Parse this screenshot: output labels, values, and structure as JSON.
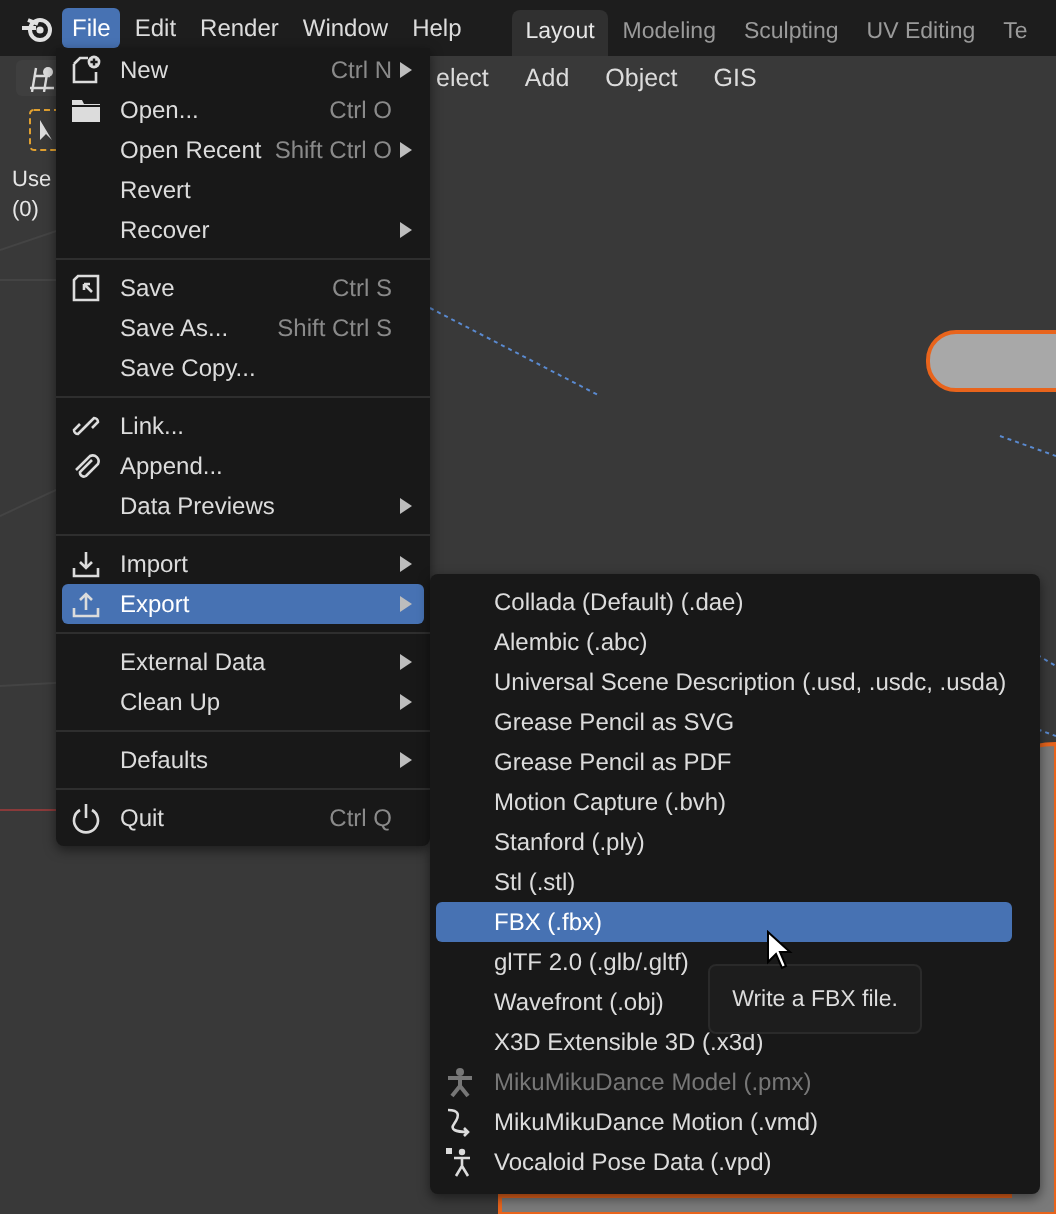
{
  "app_menu": [
    {
      "label": "File",
      "selected": true
    },
    {
      "label": "Edit",
      "selected": false
    },
    {
      "label": "Render",
      "selected": false
    },
    {
      "label": "Window",
      "selected": false
    },
    {
      "label": "Help",
      "selected": false
    }
  ],
  "workspace_tabs": [
    {
      "label": "Layout",
      "selected": true
    },
    {
      "label": "Modeling",
      "selected": false
    },
    {
      "label": "Sculpting",
      "selected": false
    },
    {
      "label": "UV Editing",
      "selected": false
    },
    {
      "label": "Te",
      "selected": false
    }
  ],
  "viewport_header": {
    "menus": [
      "elect",
      "Add",
      "Object",
      "GIS"
    ]
  },
  "viewport_overlay": [
    "Use",
    "(0)"
  ],
  "file_menu": {
    "items": [
      {
        "kind": "new",
        "label": "New",
        "shortcut": "Ctrl N",
        "submenu": true,
        "selected": false
      },
      {
        "kind": "open",
        "label": "Open...",
        "shortcut": "Ctrl O",
        "submenu": false,
        "selected": false
      },
      {
        "kind": "item",
        "label": "Open Recent",
        "shortcut": "Shift Ctrl O",
        "submenu": true,
        "selected": false
      },
      {
        "kind": "item",
        "label": "Revert",
        "submenu": false,
        "selected": false
      },
      {
        "kind": "item",
        "label": "Recover",
        "submenu": true,
        "selected": false
      },
      {
        "kind": "separator"
      },
      {
        "kind": "save",
        "label": "Save",
        "shortcut": "Ctrl S",
        "submenu": false,
        "selected": false
      },
      {
        "kind": "item",
        "label": "Save As...",
        "shortcut": "Shift Ctrl S",
        "submenu": false,
        "selected": false
      },
      {
        "kind": "item",
        "label": "Save Copy...",
        "submenu": false,
        "selected": false
      },
      {
        "kind": "separator"
      },
      {
        "kind": "link",
        "label": "Link...",
        "submenu": false,
        "selected": false
      },
      {
        "kind": "append",
        "label": "Append...",
        "submenu": false,
        "selected": false
      },
      {
        "kind": "item",
        "label": "Data Previews",
        "submenu": true,
        "selected": false
      },
      {
        "kind": "separator"
      },
      {
        "kind": "import",
        "label": "Import",
        "submenu": true,
        "selected": false
      },
      {
        "kind": "export",
        "label": "Export",
        "submenu": true,
        "selected": true
      },
      {
        "kind": "separator"
      },
      {
        "kind": "item",
        "label": "External Data",
        "submenu": true,
        "selected": false
      },
      {
        "kind": "item",
        "label": "Clean Up",
        "submenu": true,
        "selected": false
      },
      {
        "kind": "separator"
      },
      {
        "kind": "item",
        "label": "Defaults",
        "submenu": true,
        "selected": false
      },
      {
        "kind": "separator"
      },
      {
        "kind": "quit",
        "label": "Quit",
        "shortcut": "Ctrl Q",
        "submenu": false,
        "selected": false
      }
    ]
  },
  "export_menu": {
    "items": [
      {
        "label": "Collada (Default) (.dae)",
        "selected": false,
        "disabled": false
      },
      {
        "label": "Alembic (.abc)",
        "selected": false,
        "disabled": false
      },
      {
        "label": "Universal Scene Description (.usd, .usdc, .usda)",
        "selected": false,
        "disabled": false
      },
      {
        "label": "Grease Pencil as SVG",
        "selected": false,
        "disabled": false
      },
      {
        "label": "Grease Pencil as PDF",
        "selected": false,
        "disabled": false
      },
      {
        "label": "Motion Capture (.bvh)",
        "selected": false,
        "disabled": false
      },
      {
        "label": "Stanford (.ply)",
        "selected": false,
        "disabled": false
      },
      {
        "label": "Stl (.stl)",
        "selected": false,
        "disabled": false
      },
      {
        "label": "FBX (.fbx)",
        "selected": true,
        "disabled": false
      },
      {
        "label": "glTF 2.0 (.glb/.gltf)",
        "selected": false,
        "disabled": false
      },
      {
        "label": "Wavefront (.obj)",
        "selected": false,
        "disabled": false
      },
      {
        "label": "X3D Extensible 3D (.x3d)",
        "selected": false,
        "disabled": false
      },
      {
        "kind": "figure",
        "label": "MikuMikuDance Model (.pmx)",
        "selected": false,
        "disabled": true
      },
      {
        "kind": "motion",
        "label": "MikuMikuDance Motion (.vmd)",
        "selected": false,
        "disabled": false
      },
      {
        "kind": "pose",
        "label": "Vocaloid Pose Data (.vpd)",
        "selected": false,
        "disabled": false
      }
    ]
  },
  "tooltip": {
    "text": "Write a FBX file."
  }
}
